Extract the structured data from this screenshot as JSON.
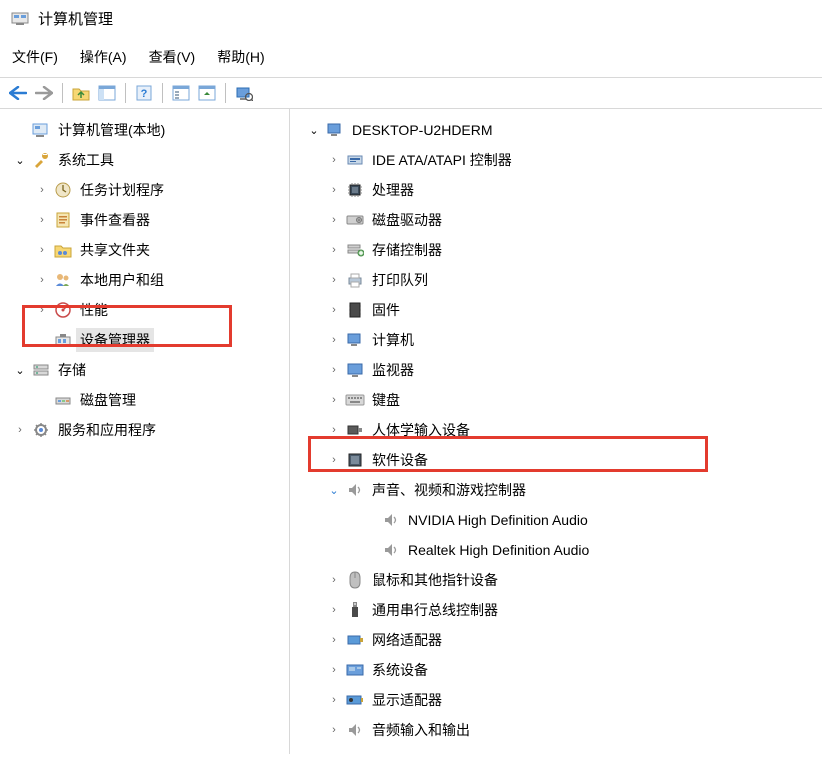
{
  "window": {
    "title": "计算机管理"
  },
  "menu": {
    "file": "文件(F)",
    "action": "操作(A)",
    "view": "查看(V)",
    "help": "帮助(H)"
  },
  "left_tree": {
    "root": "计算机管理(本地)",
    "system_tools": "系统工具",
    "task_scheduler": "任务计划程序",
    "event_viewer": "事件查看器",
    "shared_folders": "共享文件夹",
    "local_users": "本地用户和组",
    "performance": "性能",
    "device_manager": "设备管理器",
    "storage": "存储",
    "disk_mgmt": "磁盘管理",
    "services_apps": "服务和应用程序"
  },
  "right_tree": {
    "computer": "DESKTOP-U2HDERM",
    "ide": "IDE ATA/ATAPI 控制器",
    "processors": "处理器",
    "disk_drives": "磁盘驱动器",
    "storage_ctrl": "存储控制器",
    "print_queues": "打印队列",
    "firmware": "固件",
    "computers": "计算机",
    "monitors": "监视器",
    "keyboards": "键盘",
    "hid": "人体学输入设备",
    "software_devices": "软件设备",
    "sound": "声音、视频和游戏控制器",
    "nvidia_audio": "NVIDIA High Definition Audio",
    "realtek_audio": "Realtek High Definition Audio",
    "mice": "鼠标和其他指针设备",
    "usb": "通用串行总线控制器",
    "network": "网络适配器",
    "system_devices": "系统设备",
    "display_adapters": "显示适配器",
    "audio_io": "音频输入和输出"
  }
}
